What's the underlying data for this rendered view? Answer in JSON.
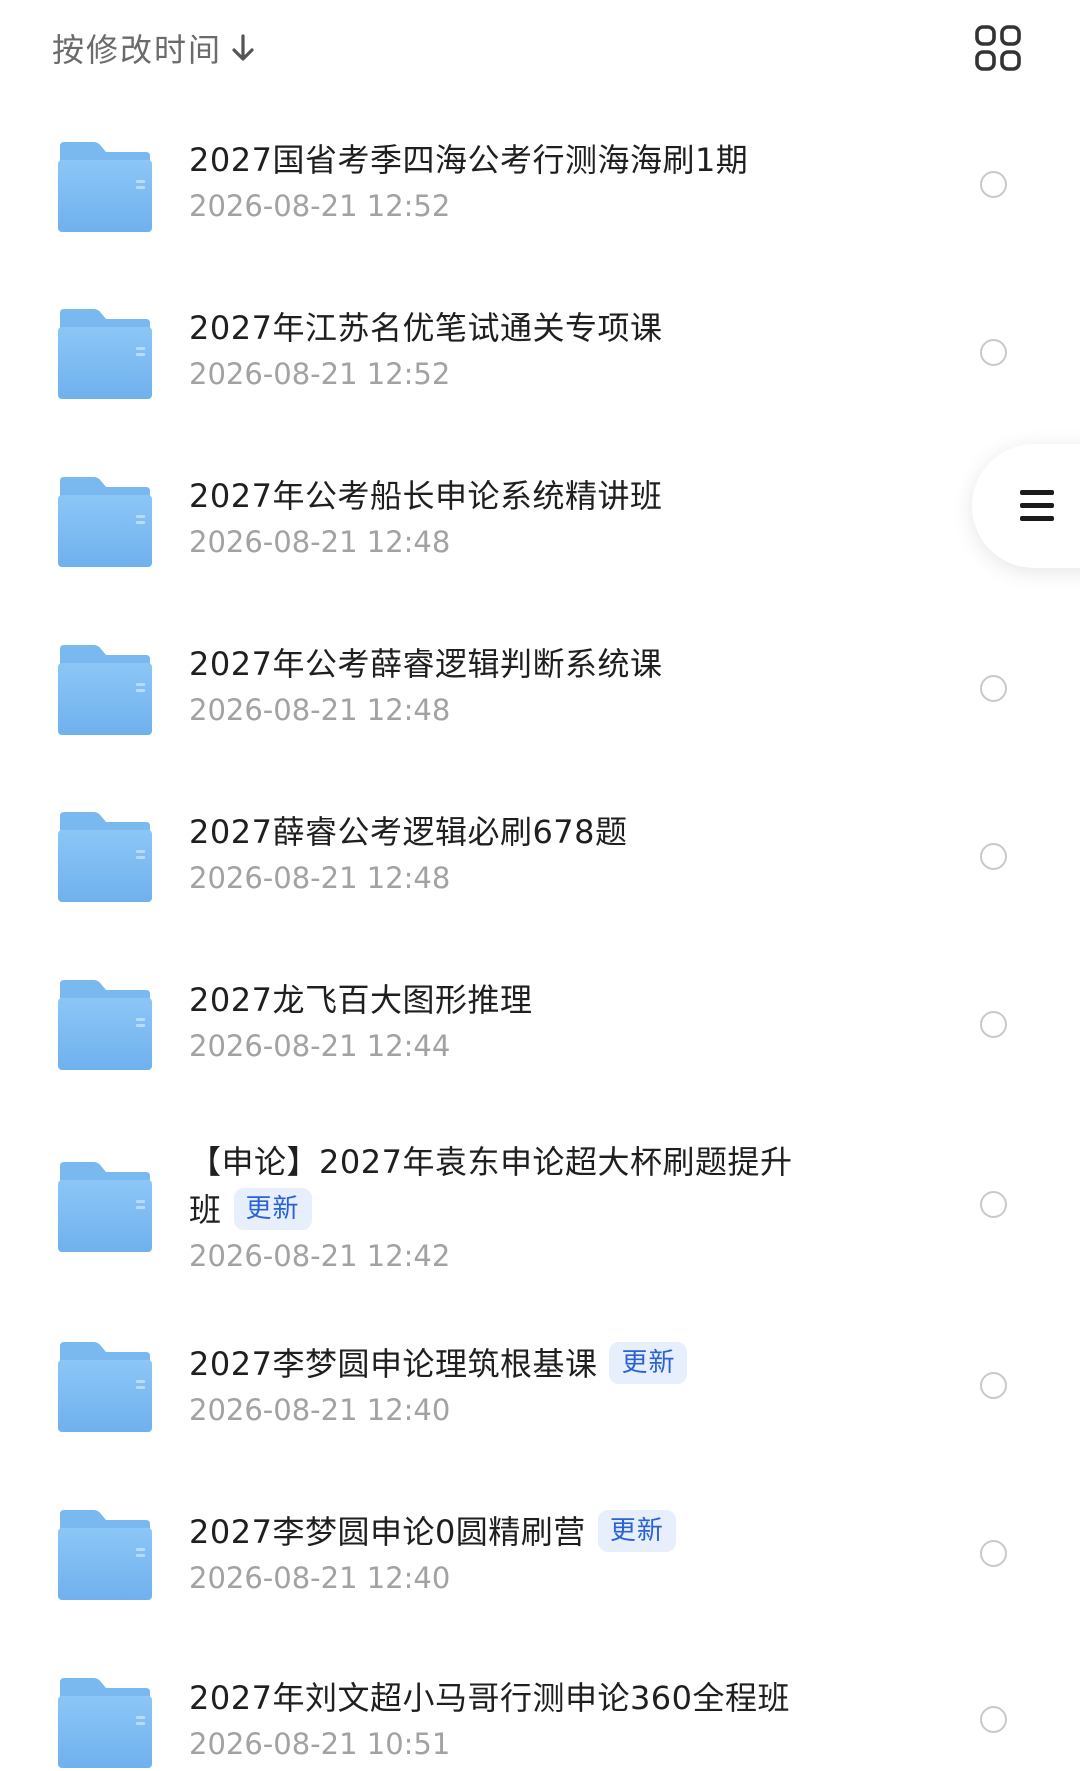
{
  "header": {
    "sort_label": "按修改时间",
    "sort_icon": "arrow-down-icon",
    "view_icon": "grid-view-icon"
  },
  "side_handle": {
    "icon": "menu-icon"
  },
  "badge_color": "#2b63d6",
  "files": [
    {
      "title": "2027国省考季四海公考行测海海刷1期",
      "date": "2026-08-21 12:52",
      "badge": ""
    },
    {
      "title": "2027年江苏名优笔试通关专项课",
      "date": "2026-08-21 12:52",
      "badge": ""
    },
    {
      "title": "2027年公考船长申论系统精讲班",
      "date": "2026-08-21 12:48",
      "badge": ""
    },
    {
      "title": "2027年公考薛睿逻辑判断系统课",
      "date": "2026-08-21 12:48",
      "badge": ""
    },
    {
      "title": "2027薛睿公考逻辑必刷678题",
      "date": "2026-08-21 12:48",
      "badge": ""
    },
    {
      "title": "2027龙飞百大图形推理",
      "date": "2026-08-21 12:44",
      "badge": ""
    },
    {
      "title": "【申论】2027年袁东申论超大杯刷题提升班",
      "date": "2026-08-21 12:42",
      "badge": "更新"
    },
    {
      "title": "2027李梦圆申论理筑根基课",
      "date": "2026-08-21 12:40",
      "badge": "更新"
    },
    {
      "title": "2027李梦圆申论0圆精刷营",
      "date": "2026-08-21 12:40",
      "badge": "更新"
    },
    {
      "title": "2027年刘文超小马哥行测申论360全程班",
      "date": "2026-08-21 10:51",
      "badge": ""
    }
  ]
}
